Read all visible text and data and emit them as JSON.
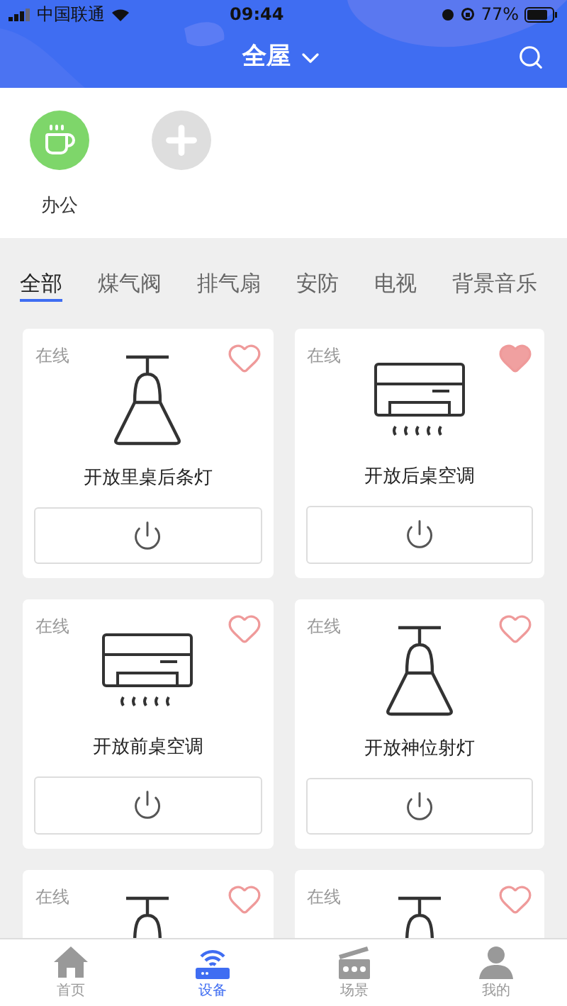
{
  "status_bar": {
    "carrier": "中国联通",
    "time": "09:44",
    "battery": "77%"
  },
  "header": {
    "title": "全屋"
  },
  "scenes": [
    {
      "kind": "scene",
      "label": "办公"
    },
    {
      "kind": "add"
    }
  ],
  "tabs": [
    {
      "label": "全部",
      "selected": true
    },
    {
      "label": "煤气阀",
      "selected": false
    },
    {
      "label": "排气扇",
      "selected": false
    },
    {
      "label": "安防",
      "selected": false
    },
    {
      "label": "电视",
      "selected": false
    },
    {
      "label": "背景音乐",
      "selected": false
    }
  ],
  "devices": [
    {
      "kind": "lamp",
      "status": "在线",
      "name": "开放里桌后条灯",
      "favorite": false
    },
    {
      "kind": "ac",
      "status": "在线",
      "name": "开放后桌空调",
      "favorite": true
    },
    {
      "kind": "ac",
      "status": "在线",
      "name": "开放前桌空调",
      "favorite": false
    },
    {
      "kind": "lamp",
      "status": "在线",
      "name": "开放神位射灯",
      "favorite": false
    },
    {
      "kind": "lamp",
      "status": "在线",
      "favorite": false
    },
    {
      "kind": "lamp",
      "status": "在线",
      "favorite": false
    }
  ],
  "nav": [
    {
      "kind": "home",
      "label": "首页",
      "selected": false
    },
    {
      "kind": "devices",
      "label": "设备",
      "selected": true
    },
    {
      "kind": "scenes",
      "label": "场景",
      "selected": false
    },
    {
      "kind": "profile",
      "label": "我的",
      "selected": false
    }
  ]
}
